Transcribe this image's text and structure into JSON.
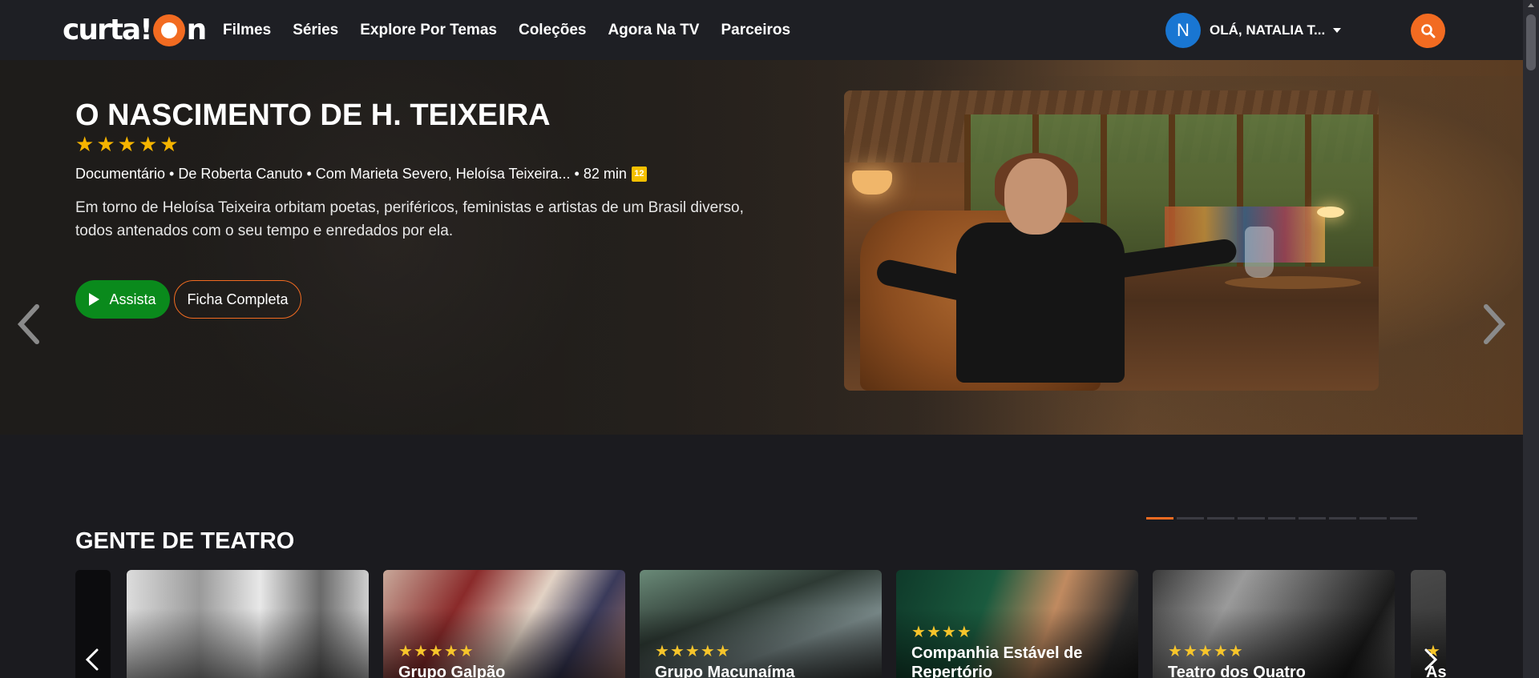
{
  "logo": {
    "text_left": "curta!",
    "text_right": "n"
  },
  "nav": [
    "Filmes",
    "Séries",
    "Explore Por Temas",
    "Coleções",
    "Agora Na TV",
    "Parceiros"
  ],
  "user": {
    "initial": "N",
    "greeting": "OLÁ, NATALIA T..."
  },
  "hero": {
    "title": "O NASCIMENTO DE H. TEIXEIRA",
    "stars": 5,
    "meta": "Documentário • De Roberta Canuto • Com Marieta Severo, Heloísa Teixeira... • 82 min",
    "age_rating": "12",
    "synopsis": "Em torno de Heloísa Teixeira orbitam poetas, periféricos, feministas e artistas de um Brasil diverso, todos antenados com o seu tempo e enredados por ela.",
    "watch_label": "Assista",
    "details_label": "Ficha Completa"
  },
  "carousel": {
    "pages": 9,
    "active_page": 1
  },
  "section": {
    "title": "GENTE DE TEATRO",
    "cards": [
      {
        "title": "",
        "stars": 0
      },
      {
        "title": "Grupo Galpão",
        "stars": 5
      },
      {
        "title": "Grupo Macunaíma",
        "stars": 5
      },
      {
        "title": "Companhia Estável de Repertório",
        "stars": 4
      },
      {
        "title": "Teatro dos Quatro",
        "stars": 5
      },
      {
        "title": "As",
        "stars": 1
      }
    ]
  },
  "colors": {
    "accent": "#f26b21",
    "watch": "#0a8a1c",
    "star": "#f5b400",
    "avatar": "#1976d2"
  }
}
